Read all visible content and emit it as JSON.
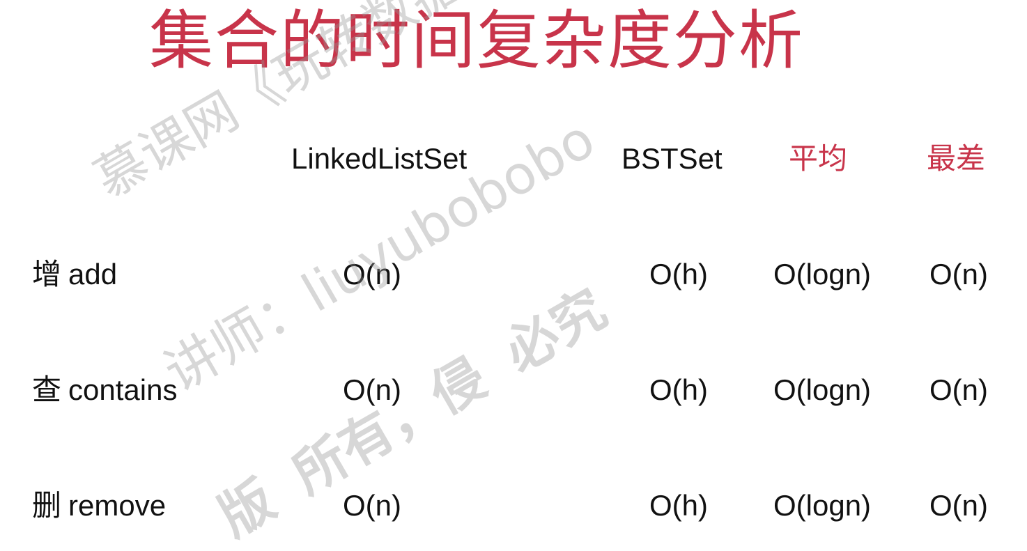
{
  "title": "集合的时间复杂度分析",
  "table": {
    "headers": [
      "LinkedListSet",
      "BSTSet",
      "平均",
      "最差"
    ],
    "rows": [
      {
        "op_zh": "增",
        "op_en": "add",
        "linked": "O(n)",
        "bst": "O(h)",
        "avg": "O(logn)",
        "worst": "O(n)"
      },
      {
        "op_zh": "查",
        "op_en": "contains",
        "linked": "O(n)",
        "bst": "O(h)",
        "avg": "O(logn)",
        "worst": "O(n)"
      },
      {
        "op_zh": "删",
        "op_en": "remove",
        "linked": "O(n)",
        "bst": "O(h)",
        "avg": "O(logn)",
        "worst": "O(n)"
      }
    ]
  },
  "watermark": {
    "line1": "慕课网《玩转数据结构》",
    "line2": "讲师：liuyubobobo",
    "line3": "版  所有，侵  必究"
  },
  "colors": {
    "accent": "#c8344a",
    "text": "#111111",
    "watermark": "#969696"
  }
}
